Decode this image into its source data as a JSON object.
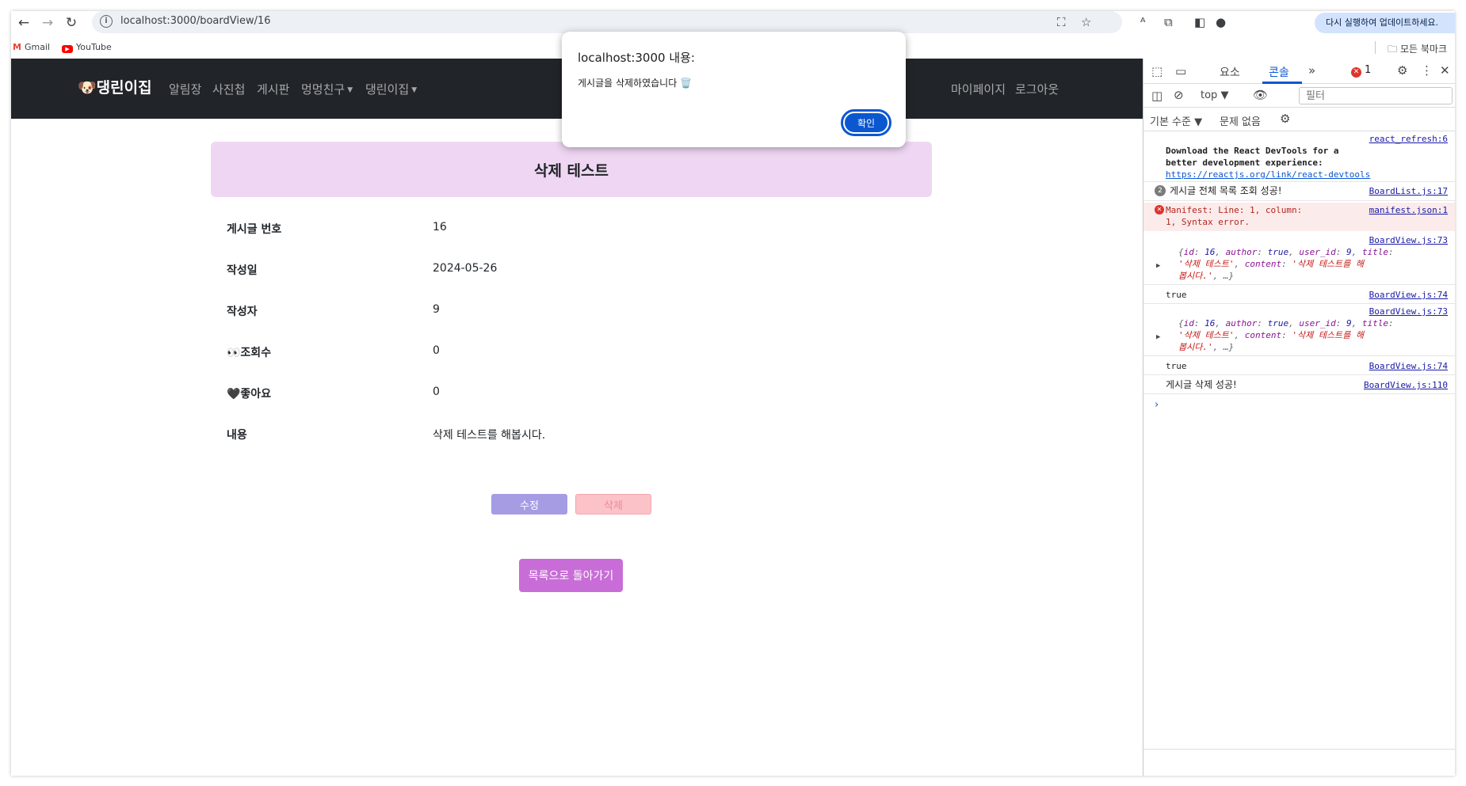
{
  "browser": {
    "url": "localhost:3000/boardView/16",
    "update_label": "다시 실행하여 업데이트하세요.",
    "bookmarks": [
      {
        "label": "Gmail"
      },
      {
        "label": "YouTube"
      }
    ],
    "all_bookmarks_label": "모든 북마크"
  },
  "navbar": {
    "brand": "댕린이집",
    "items": [
      "알림장",
      "사진첩",
      "게시판",
      "멍멍친구",
      "댕린이집"
    ],
    "right_items": [
      "마이페이지",
      "로그아웃"
    ]
  },
  "post": {
    "title": "삭제 테스트",
    "rows": [
      {
        "label": "게시글 번호",
        "value": "16"
      },
      {
        "label": "작성일",
        "value": "2024-05-26"
      },
      {
        "label": "작성자",
        "value": "9"
      },
      {
        "label": "👀조회수",
        "value": "0"
      },
      {
        "label": "🖤좋아요",
        "value": "0"
      },
      {
        "label": "내용",
        "value": "삭제 테스트를 해봅시다."
      }
    ],
    "edit_label": "수정",
    "delete_label": "삭제",
    "back_label": "목록으로 돌아가기"
  },
  "alert": {
    "title": "localhost:3000 내용:",
    "message": "게시글을 삭제하였습니다 🗑️",
    "ok_label": "확인"
  },
  "devtools": {
    "tabs": [
      "요소",
      "콘솔"
    ],
    "active_tab": "콘솔",
    "error_count": "1",
    "context": "top",
    "filter_placeholder": "필터",
    "level": "기본 수준",
    "issues": "문제 없음",
    "logs": {
      "react_src": "react_refresh:6",
      "react_msg1": "Download the React DevTools for a",
      "react_msg2": "better development experience:",
      "react_link": "https://reactjs.org/link/react-devtools",
      "list_count": "2",
      "list_msg": "게시글 전체 목록 조회 성공!",
      "list_src": "BoardList.js:17",
      "manifest_msg1": "Manifest: Line: 1, column:",
      "manifest_msg2": "1, Syntax error.",
      "manifest_src": "manifest.json:1",
      "view73_src": "BoardView.js:73",
      "view74_src": "BoardView.js:74",
      "view110_src": "BoardView.js:110",
      "true_val": "true",
      "delete_msg": "게시글 삭제 성공!",
      "obj_line1_prefix": "{",
      "obj_id_key": "id",
      "obj_id_val": "16",
      "obj_author_key": "author",
      "obj_author_val": "true",
      "obj_userid_key": "user_id",
      "obj_userid_val": "9",
      "obj_title_key": "title",
      "obj_title_val": "'삭제 테스트'",
      "obj_content_key": "content",
      "obj_content_val1": "'삭제 테스트를 해",
      "obj_content_val2": "봅시다.'",
      "obj_rest": ", …}"
    }
  },
  "colors": {
    "navbar_bg": "#212529",
    "title_box_bg": "#efd7f3",
    "edit_button": "#a59ce4",
    "delete_button": "#fbc2c8",
    "back_button": "#c86dd7",
    "alert_ok": "#0b57d0"
  }
}
